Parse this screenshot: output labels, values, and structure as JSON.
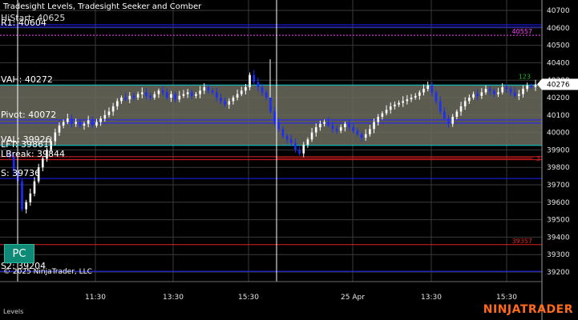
{
  "indicator_title": "Tradesight Levels, Tradesight Seeker and Comber",
  "copyright": "© 2025 NinjaTrader, LLC",
  "pc_button": "PC",
  "tab_label": "Levels",
  "brand": "NINJATRADER",
  "colors": {
    "background": "#000000",
    "grid": "#3a3a3a",
    "value_area": "#6b6b5e",
    "vah_line": "#00d0d0",
    "pivot_line": "#2020ff",
    "support_line": "#2020ff",
    "resistance_line": "#2020ff",
    "red_line": "#e02020",
    "magenta_line": "#ff40ff",
    "up_candle": "#ffffff",
    "down_candle": "#1a2cff",
    "session_line": "#ffffff"
  },
  "chart_data": {
    "type": "candlestick",
    "title": "",
    "ylim": [
      39150,
      40750
    ],
    "y_ticks": [
      39200,
      39300,
      39400,
      39500,
      39600,
      39700,
      39800,
      39900,
      40000,
      40100,
      40200,
      40300,
      40400,
      40500,
      40600,
      40700
    ],
    "x_ticks": [
      "11:30",
      "13:30",
      "15:30",
      "25 Apr",
      "13:30",
      "15:30"
    ],
    "current_price": "40276",
    "levels": [
      {
        "label": "R1: 40604",
        "value": 40604,
        "kind": "resistance"
      },
      {
        "label": "VAH: 40272",
        "value": 40272,
        "kind": "vah"
      },
      {
        "label": "Pivot: 40072",
        "value": 40072,
        "kind": "pivot"
      },
      {
        "label": "VAL: 39926",
        "value": 39926,
        "kind": "val"
      },
      {
        "label": "LFT: 39861",
        "value": 39861,
        "kind": "lft"
      },
      {
        "label": "LBreak: 39844",
        "value": 39844,
        "kind": "lbreak"
      },
      {
        "label": "S: 39736",
        "value": 39736,
        "kind": "support"
      },
      {
        "label": "S2: 39204",
        "value": 39204,
        "kind": "support2"
      }
    ],
    "overlapping_label": "HiStart: 40625",
    "right_markers": [
      {
        "label": "40557",
        "value": 40557,
        "color": "#ff40ff"
      },
      {
        "label": "39357",
        "value": 39357,
        "color": "#e02020"
      },
      {
        "label": "3",
        "value": 39850,
        "color": "#e02020"
      },
      {
        "label": "123",
        "value": 40290,
        "color": "#22bb22"
      }
    ],
    "closes": [
      39860,
      39780,
      39720,
      39560,
      39600,
      39650,
      39720,
      39800,
      39850,
      39900,
      39950,
      40000,
      40040,
      40060,
      40080,
      40050,
      40060,
      40040,
      40050,
      40070,
      40040,
      40060,
      40080,
      40100,
      40120,
      40150,
      40180,
      40200,
      40190,
      40210,
      40200,
      40220,
      40230,
      40210,
      40200,
      40220,
      40240,
      40230,
      40200,
      40220,
      40190,
      40210,
      40220,
      40230,
      40210,
      40220,
      40240,
      40260,
      40240,
      40230,
      40200,
      40180,
      40160,
      40180,
      40200,
      40220,
      40240,
      40260,
      40330,
      40290,
      40260,
      40230,
      40200,
      40120,
      40060,
      40020,
      39980,
      39960,
      39940,
      39900,
      39880,
      39930,
      39960,
      40000,
      40030,
      40050,
      40060,
      40040,
      40020,
      40010,
      40030,
      40050,
      40030,
      40010,
      39990,
      39970,
      39990,
      40020,
      40060,
      40090,
      40110,
      40130,
      40150,
      40160,
      40170,
      40180,
      40190,
      40200,
      40210,
      40230,
      40250,
      40270,
      40230,
      40180,
      40120,
      40080,
      40050,
      40090,
      40120,
      40150,
      40180,
      40200,
      40220,
      40210,
      40230,
      40250,
      40240,
      40220,
      40230,
      40260,
      40250,
      40230,
      40210,
      40220,
      40250,
      40270,
      40260,
      40276
    ]
  }
}
